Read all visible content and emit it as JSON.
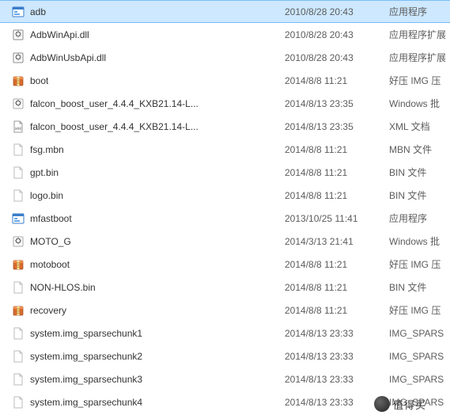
{
  "files": [
    {
      "icon": "exe",
      "name": "adb",
      "date": "2010/8/28 20:43",
      "type": "应用程序",
      "selected": true
    },
    {
      "icon": "dll",
      "name": "AdbWinApi.dll",
      "date": "2010/8/28 20:43",
      "type": "应用程序扩展",
      "selected": false
    },
    {
      "icon": "dll",
      "name": "AdbWinUsbApi.dll",
      "date": "2010/8/28 20:43",
      "type": "应用程序扩展",
      "selected": false
    },
    {
      "icon": "archive",
      "name": "boot",
      "date": "2014/8/8 11:21",
      "type": "好压 IMG 压",
      "selected": false
    },
    {
      "icon": "batch",
      "name": "falcon_boost_user_4.4.4_KXB21.14-L...",
      "date": "2014/8/13 23:35",
      "type": "Windows 批",
      "selected": false
    },
    {
      "icon": "xml",
      "name": "falcon_boost_user_4.4.4_KXB21.14-L...",
      "date": "2014/8/13 23:35",
      "type": "XML 文档",
      "selected": false
    },
    {
      "icon": "file",
      "name": "fsg.mbn",
      "date": "2014/8/8 11:21",
      "type": "MBN 文件",
      "selected": false
    },
    {
      "icon": "file",
      "name": "gpt.bin",
      "date": "2014/8/8 11:21",
      "type": "BIN 文件",
      "selected": false
    },
    {
      "icon": "file",
      "name": "logo.bin",
      "date": "2014/8/8 11:21",
      "type": "BIN 文件",
      "selected": false
    },
    {
      "icon": "exe",
      "name": "mfastboot",
      "date": "2013/10/25 11:41",
      "type": "应用程序",
      "selected": false
    },
    {
      "icon": "batch",
      "name": "MOTO_G",
      "date": "2014/3/13 21:41",
      "type": "Windows 批",
      "selected": false
    },
    {
      "icon": "archive",
      "name": "motoboot",
      "date": "2014/8/8 11:21",
      "type": "好压 IMG 压",
      "selected": false
    },
    {
      "icon": "file",
      "name": "NON-HLOS.bin",
      "date": "2014/8/8 11:21",
      "type": "BIN 文件",
      "selected": false
    },
    {
      "icon": "archive",
      "name": "recovery",
      "date": "2014/8/8 11:21",
      "type": "好压 IMG 压",
      "selected": false
    },
    {
      "icon": "file",
      "name": "system.img_sparsechunk1",
      "date": "2014/8/13 23:33",
      "type": "IMG_SPARS",
      "selected": false
    },
    {
      "icon": "file",
      "name": "system.img_sparsechunk2",
      "date": "2014/8/13 23:33",
      "type": "IMG_SPARS",
      "selected": false
    },
    {
      "icon": "file",
      "name": "system.img_sparsechunk3",
      "date": "2014/8/13 23:33",
      "type": "IMG_SPARS",
      "selected": false
    },
    {
      "icon": "file",
      "name": "system.img_sparsechunk4",
      "date": "2014/8/13 23:33",
      "type": "IMG_SPARS",
      "selected": false
    }
  ],
  "watermark": {
    "text": "值得买"
  }
}
